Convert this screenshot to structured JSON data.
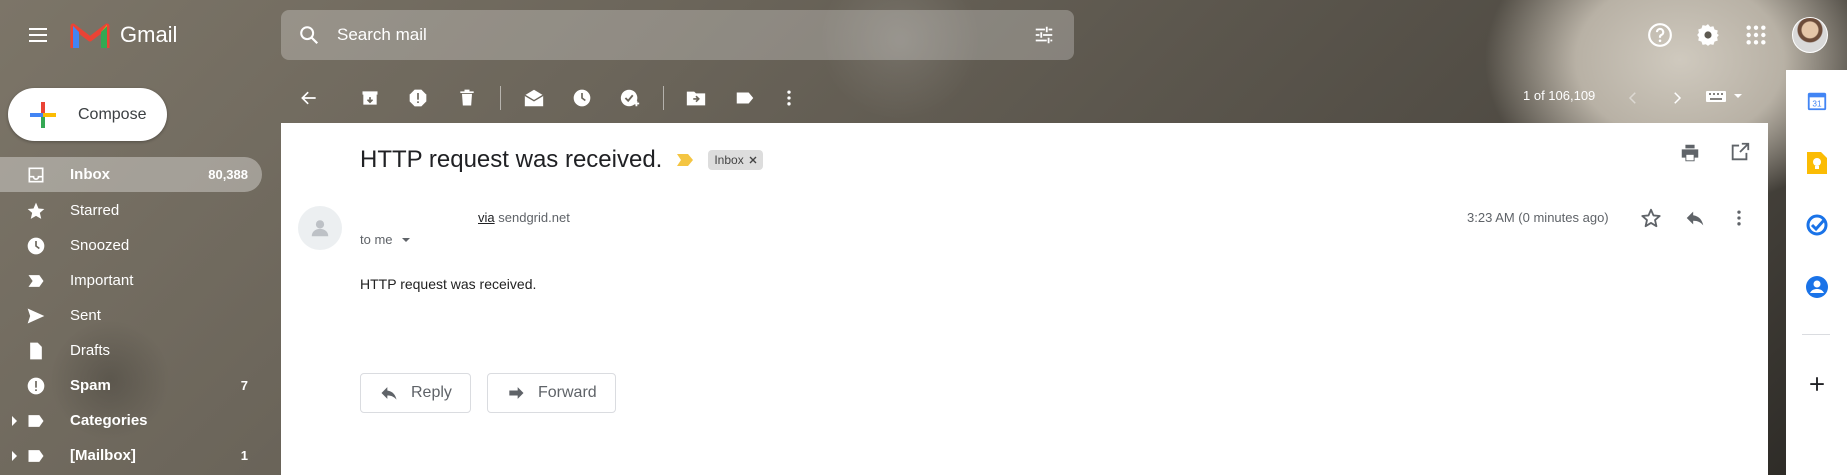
{
  "header": {
    "app_name": "Gmail",
    "search_placeholder": "Search mail"
  },
  "sidebar": {
    "compose_label": "Compose",
    "items": [
      {
        "label": "Inbox",
        "count": "80,388",
        "icon": "inbox-icon"
      },
      {
        "label": "Starred",
        "count": "",
        "icon": "star-icon"
      },
      {
        "label": "Snoozed",
        "count": "",
        "icon": "clock-icon"
      },
      {
        "label": "Important",
        "count": "",
        "icon": "important-icon"
      },
      {
        "label": "Sent",
        "count": "",
        "icon": "send-icon"
      },
      {
        "label": "Drafts",
        "count": "",
        "icon": "draft-icon"
      },
      {
        "label": "Spam",
        "count": "7",
        "icon": "spam-icon"
      },
      {
        "label": "Categories",
        "count": "",
        "icon": "label-icon"
      },
      {
        "label": "[Mailbox]",
        "count": "1",
        "icon": "label-icon"
      }
    ]
  },
  "toolbar": {
    "pager_text": "1 of 106,109"
  },
  "message": {
    "subject": "HTTP request was received.",
    "label_chip": "Inbox",
    "via_word": "via",
    "via_domain": "sendgrid.net",
    "to_text": "to me",
    "timestamp": "3:23 AM (0 minutes ago)",
    "body": "HTTP request was received."
  },
  "actions": {
    "reply_label": "Reply",
    "forward_label": "Forward"
  },
  "colors": {
    "accent_blue": "#1a73e8",
    "keep_yellow": "#fbbc04",
    "importance_marker": "#f4c542"
  }
}
